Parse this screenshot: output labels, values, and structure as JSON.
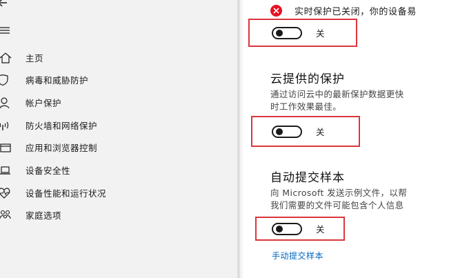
{
  "sidebar": {
    "items": [
      {
        "label": "主页",
        "icon": "home-icon"
      },
      {
        "label": "病毒和威胁防护",
        "icon": "shield-icon"
      },
      {
        "label": "帐户保护",
        "icon": "person-icon"
      },
      {
        "label": "防火墙和网络保护",
        "icon": "wifi-signal-icon"
      },
      {
        "label": "应用和浏览器控制",
        "icon": "app-window-icon"
      },
      {
        "label": "设备安全性",
        "icon": "laptop-icon"
      },
      {
        "label": "设备性能和运行状况",
        "icon": "heart-pulse-icon"
      },
      {
        "label": "家庭选项",
        "icon": "family-icon"
      }
    ]
  },
  "realtime": {
    "warning_text": "实时保护已关闭，你的设备易",
    "toggle_label": "关"
  },
  "cloud": {
    "title": "云提供的保护",
    "desc_line1": "通过访问云中的最新保护数据更快",
    "desc_line2": "时工作效果最佳。",
    "toggle_label": "关"
  },
  "sample": {
    "title": "自动提交样本",
    "desc_line1": "向 Microsoft 发送示例文件，以帮",
    "desc_line2": "我们需要的文件可能包含个人信息",
    "toggle_label": "关",
    "link": "手动提交样本"
  },
  "colors": {
    "sidebar_bg": "#f2f2f2",
    "warning_red": "#e81123",
    "highlight_box": "#d9353b",
    "link_blue": "#0067c0"
  }
}
